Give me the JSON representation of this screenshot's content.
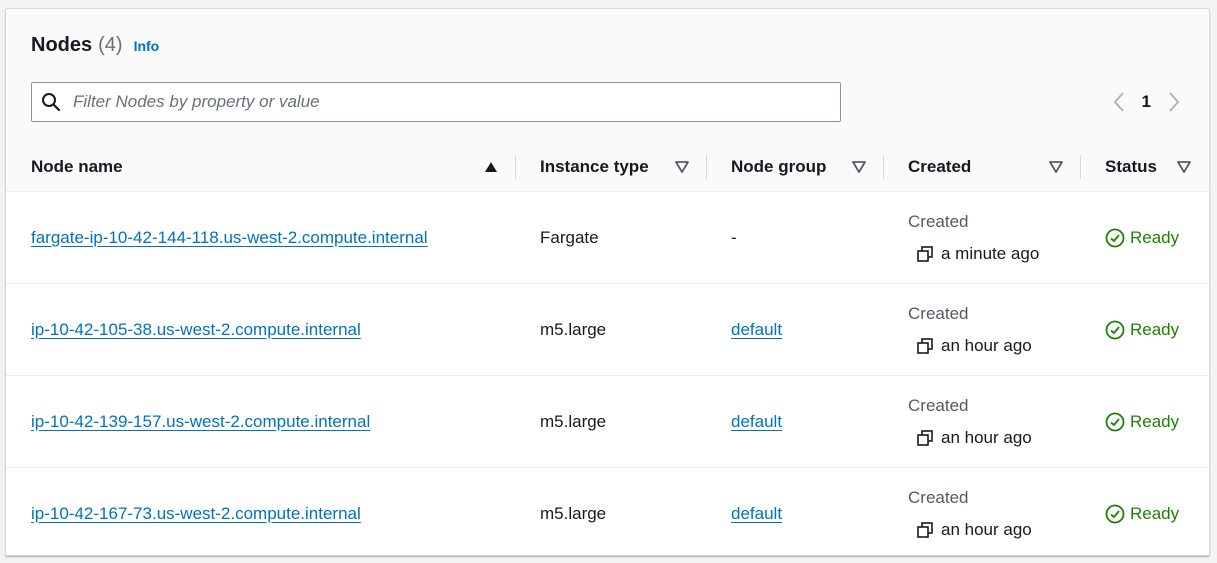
{
  "header": {
    "title": "Nodes",
    "count": "(4)",
    "info_label": "Info"
  },
  "search": {
    "placeholder": "Filter Nodes by property or value",
    "value": ""
  },
  "pagination": {
    "current_page": "1"
  },
  "columns": [
    {
      "label": "Node name",
      "sort": "ascending"
    },
    {
      "label": "Instance type",
      "sort": "none"
    },
    {
      "label": "Node group",
      "sort": "none"
    },
    {
      "label": "Created",
      "sort": "none"
    },
    {
      "label": "Status",
      "sort": "none"
    }
  ],
  "rows": [
    {
      "name": "fargate-ip-10-42-144-118.us-west-2.compute.internal",
      "instance_type": "Fargate",
      "node_group": "-",
      "created_label": "Created",
      "created_time": "a minute ago",
      "status": "Ready"
    },
    {
      "name": "ip-10-42-105-38.us-west-2.compute.internal",
      "instance_type": "m5.large",
      "node_group": "default",
      "created_label": "Created",
      "created_time": "an hour ago",
      "status": "Ready"
    },
    {
      "name": "ip-10-42-139-157.us-west-2.compute.internal",
      "instance_type": "m5.large",
      "node_group": "default",
      "created_label": "Created",
      "created_time": "an hour ago",
      "status": "Ready"
    },
    {
      "name": "ip-10-42-167-73.us-west-2.compute.internal",
      "instance_type": "m5.large",
      "node_group": "default",
      "created_label": "Created",
      "created_time": "an hour ago",
      "status": "Ready"
    }
  ],
  "colors": {
    "link": "#0073bb",
    "success": "#1d8102",
    "text": "#16191f",
    "muted": "#687078"
  }
}
